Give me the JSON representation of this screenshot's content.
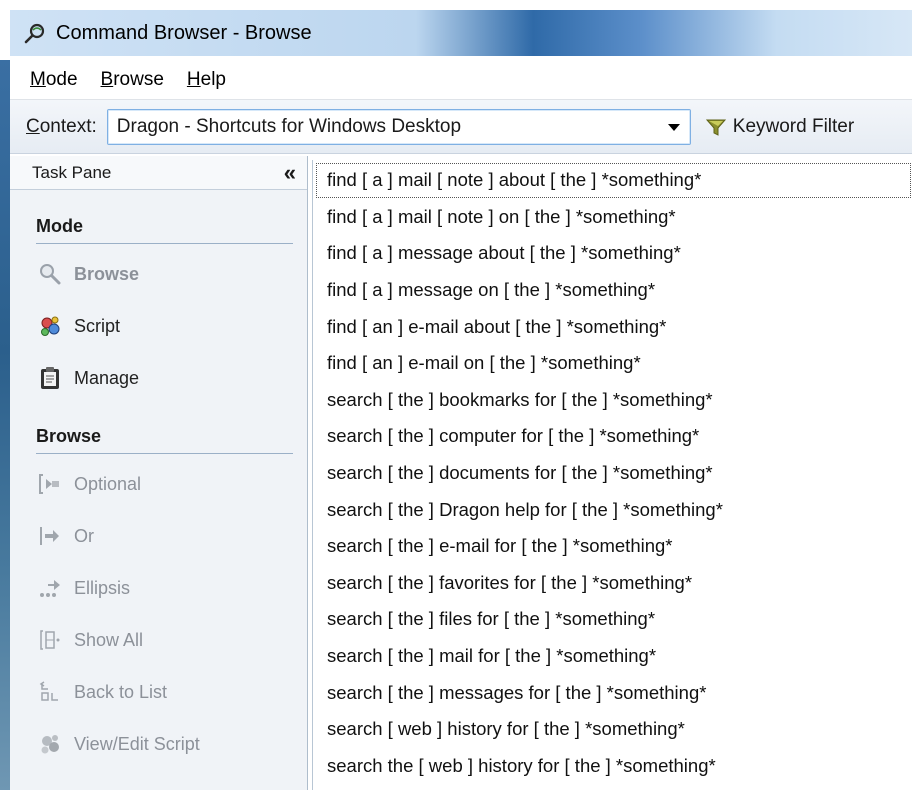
{
  "window": {
    "title": "Command Browser - Browse"
  },
  "menu": [
    {
      "underline": "M",
      "rest": "ode"
    },
    {
      "underline": "B",
      "rest": "rowse"
    },
    {
      "underline": "H",
      "rest": "elp"
    }
  ],
  "context": {
    "label_underline": "C",
    "label_rest": "ontext:",
    "value": "Dragon - Shortcuts for Windows Desktop",
    "filter_label": "Keyword Filter"
  },
  "task_pane": {
    "title": "Task Pane",
    "collapse_glyph": "«",
    "mode_title": "Mode",
    "mode_items": [
      "Browse",
      "Script",
      "Manage"
    ],
    "browse_title": "Browse",
    "browse_items": [
      "Optional",
      "Or",
      "Ellipsis",
      "Show All",
      "Back to List",
      "View/Edit Script"
    ]
  },
  "commands": [
    "find [ a ] mail [ note ] about [ the ] *something*",
    "find [ a ] mail [ note ] on [ the ] *something*",
    "find [ a ] message about [ the ] *something*",
    "find [ a ] message on [ the ] *something*",
    "find [ an ] e-mail about [ the ] *something*",
    "find [ an ] e-mail on [ the ] *something*",
    "search [ the ] bookmarks for [ the ] *something*",
    "search [ the ] computer for [ the ] *something*",
    "search [ the ] documents for [ the ] *something*",
    "search [ the ] Dragon help for [ the ] *something*",
    "search [ the ] e-mail for [ the ] *something*",
    "search [ the ] favorites for [ the ] *something*",
    "search [ the ] files for [ the ] *something*",
    "search [ the ] mail for [ the ] *something*",
    "search [ the ] messages for [ the ] *something*",
    "search [ web ] history for [ the ] *something*",
    "search the [ web ] history for [ the ] *something*"
  ]
}
